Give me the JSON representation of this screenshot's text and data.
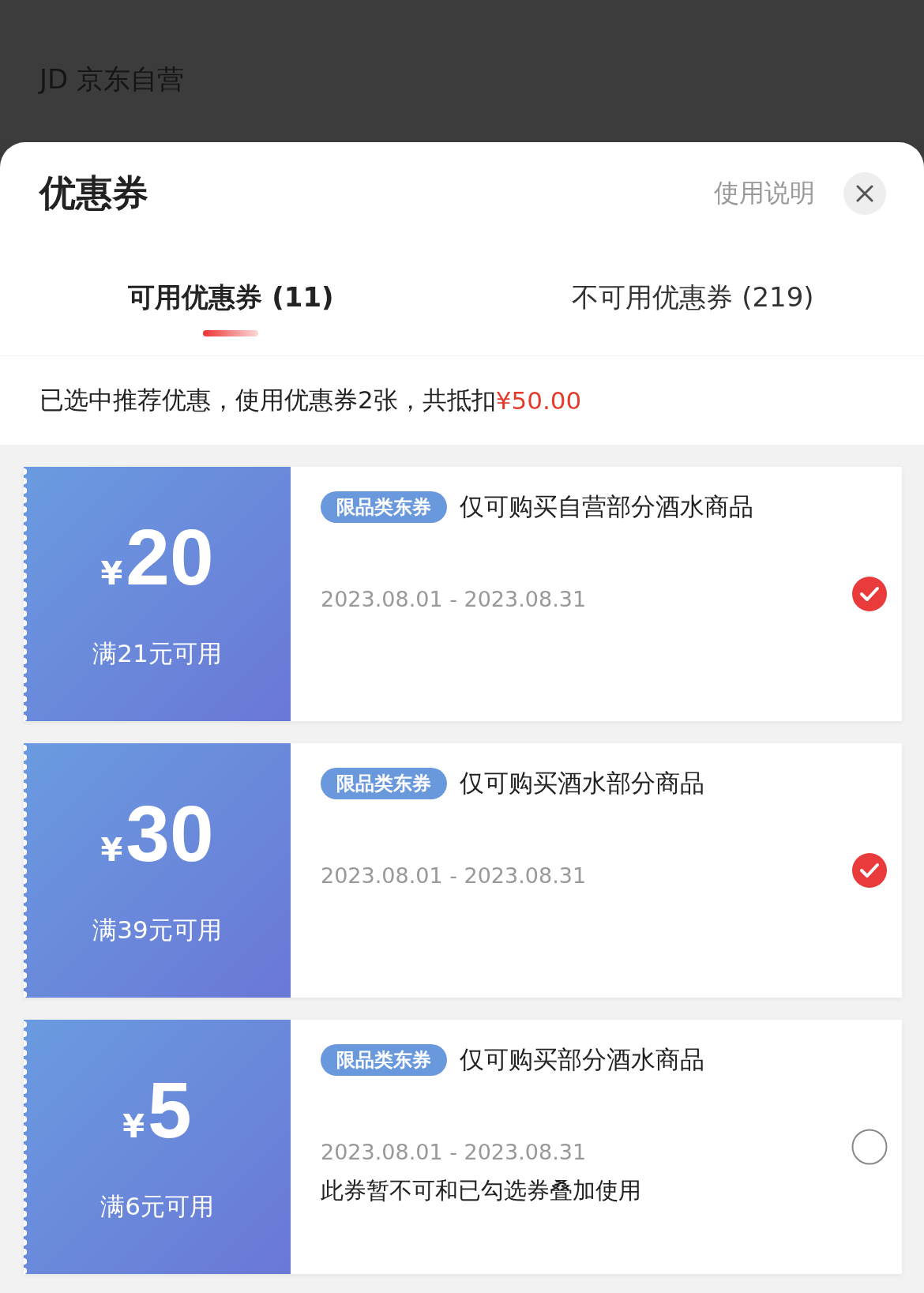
{
  "background_page": {
    "store_label": "JD 京东自营"
  },
  "sheet": {
    "title": "优惠券",
    "help_link": "使用说明"
  },
  "tabs": [
    {
      "label": "可用优惠券 (11)",
      "selected": true
    },
    {
      "label": "不可用优惠券 (219)",
      "selected": false
    }
  ],
  "summary": {
    "text": "已选中推荐优惠，使用优惠券2张，共抵扣",
    "amount": "¥50.00"
  },
  "coupons": [
    {
      "currency": "¥",
      "amount": "20",
      "condition": "满21元可用",
      "tag": "限品类东券",
      "title": "仅可购买自营部分酒水商品",
      "validity": "2023.08.01 - 2023.08.31",
      "selected": true
    },
    {
      "currency": "¥",
      "amount": "30",
      "condition": "满39元可用",
      "tag": "限品类东券",
      "title": "仅可购买酒水部分商品",
      "validity": "2023.08.01 - 2023.08.31",
      "selected": true
    },
    {
      "currency": "¥",
      "amount": "5",
      "condition": "满6元可用",
      "tag": "限品类东券",
      "title": "仅可购买部分酒水商品",
      "validity": "2023.08.01 - 2023.08.31",
      "note": "此券暂不可和已勾选券叠加使用",
      "selected": false
    }
  ]
}
